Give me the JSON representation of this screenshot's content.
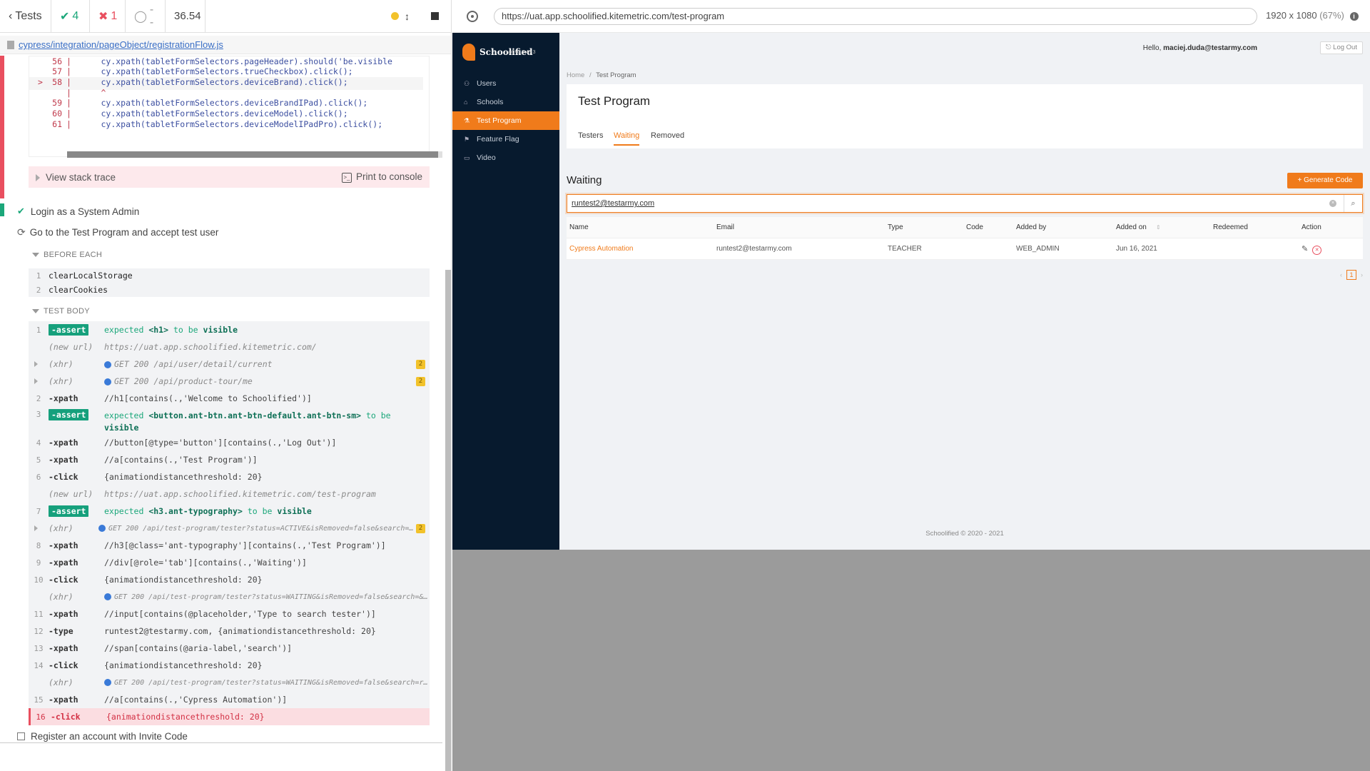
{
  "runner": {
    "tests_label": "Tests",
    "passed": "4",
    "failed": "1",
    "pending": "--",
    "duration": "36.54",
    "spec_path": "cypress/integration/pageObject/registrationFlow.js",
    "code_lines": [
      {
        "ln": "56",
        "arrow": "",
        "code": "      cy.xpath(tabletFormSelectors.pageHeader).should('be.visible"
      },
      {
        "ln": "57",
        "arrow": "",
        "code": "      cy.xpath(tabletFormSelectors.trueCheckbox).click();"
      },
      {
        "ln": "58",
        "arrow": ">",
        "code": "      cy.xpath(tabletFormSelectors.deviceBrand).click();"
      },
      {
        "ln": "",
        "arrow": "",
        "code": "      ^"
      },
      {
        "ln": "59",
        "arrow": "",
        "code": "      cy.xpath(tabletFormSelectors.deviceBrandIPad).click();"
      },
      {
        "ln": "60",
        "arrow": "",
        "code": "      cy.xpath(tabletFormSelectors.deviceModel).click();"
      },
      {
        "ln": "61",
        "arrow": "",
        "code": "      cy.xpath(tabletFormSelectors.deviceModelIPadPro).click();"
      }
    ],
    "view_stack_trace": "View stack trace",
    "print_to_console": "Print to console",
    "tests": {
      "t1": "Login as a System Admin",
      "t2": "Go to the Test Program and accept test user",
      "t3": "Register an account with Invite Code"
    },
    "before_each": "BEFORE EACH",
    "before_each_cmds": [
      {
        "num": "1",
        "msg": "clearLocalStorage"
      },
      {
        "num": "2",
        "msg": "clearCookies"
      }
    ],
    "test_body": "TEST BODY",
    "commands": {
      "c1": {
        "num": "1",
        "name": "-assert",
        "pre": "expected",
        "el": "<h1>",
        "mid": "to be",
        "end": "visible"
      },
      "u1": {
        "name": "(new url)",
        "msg": "https://uat.app.schoolified.kitemetric.com/"
      },
      "x1": {
        "name": "(xhr)",
        "msg": "GET 200 /api/user/detail/current",
        "badge": "2"
      },
      "x2": {
        "name": "(xhr)",
        "msg": "GET 200 /api/product-tour/me",
        "badge": "2"
      },
      "c2": {
        "num": "2",
        "name": "-xpath",
        "msg": "//h1[contains(.,'Welcome to Schoolified')]"
      },
      "c3": {
        "num": "3",
        "name": "-assert",
        "pre": "expected",
        "el": "<button.ant-btn.ant-btn-default.ant-btn-sm>",
        "mid": "to be",
        "end": "visible"
      },
      "c4": {
        "num": "4",
        "name": "-xpath",
        "msg": "//button[@type='button'][contains(.,'Log Out')]"
      },
      "c5": {
        "num": "5",
        "name": "-xpath",
        "msg": "//a[contains(.,'Test Program')]"
      },
      "c6": {
        "num": "6",
        "name": "-click",
        "msg": "{animationdistancethreshold: 20}"
      },
      "u2": {
        "name": "(new url)",
        "msg": "https://uat.app.schoolified.kitemetric.com/test-program"
      },
      "c7": {
        "num": "7",
        "name": "-assert",
        "pre": "expected",
        "el": "<h3.ant-typography>",
        "mid": "to be",
        "end": "visible"
      },
      "x3": {
        "name": "(xhr)",
        "msg": "GET 200 /api/test-program/tester?status=ACTIVE&isRemoved=false&search=&size…",
        "badge": "2"
      },
      "c8": {
        "num": "8",
        "name": "-xpath",
        "msg": "//h3[@class='ant-typography'][contains(.,'Test Program')]"
      },
      "c9": {
        "num": "9",
        "name": "-xpath",
        "msg": "//div[@role='tab'][contains(.,'Waiting')]"
      },
      "c10": {
        "num": "10",
        "name": "-click",
        "msg": "{animationdistancethreshold: 20}"
      },
      "x4": {
        "name": "(xhr)",
        "msg": "GET 200 /api/test-program/tester?status=WAITING&isRemoved=false&search=&size…"
      },
      "c11": {
        "num": "11",
        "name": "-xpath",
        "msg": "//input[contains(@placeholder,'Type to search tester')]"
      },
      "c12": {
        "num": "12",
        "name": "-type",
        "msg": "runtest2@testarmy.com, {animationdistancethreshold: 20}"
      },
      "c13": {
        "num": "13",
        "name": "-xpath",
        "msg": "//span[contains(@aria-label,'search')]"
      },
      "c14": {
        "num": "14",
        "name": "-click",
        "msg": "{animationdistancethreshold: 20}"
      },
      "x5": {
        "name": "(xhr)",
        "msg": "GET 200 /api/test-program/tester?status=WAITING&isRemoved=false&search=runte…"
      },
      "c15": {
        "num": "15",
        "name": "-xpath",
        "msg": "//a[contains(.,'Cypress Automation')]"
      },
      "c16": {
        "num": "16",
        "name": "-click",
        "msg": "{animationdistancethreshold: 20}"
      }
    }
  },
  "aut_bar": {
    "url": "https://uat.app.schoolified.kitemetric.com/test-program",
    "viewport": "1920 x 1080",
    "scale": "(67%)"
  },
  "app": {
    "brand": "Schoolified",
    "version": "uat v0.3.49.3",
    "nav": [
      {
        "label": "Users",
        "icon": "user-icon"
      },
      {
        "label": "Schools",
        "icon": "home-icon"
      },
      {
        "label": "Test Program",
        "icon": "flask-icon"
      },
      {
        "label": "Feature Flag",
        "icon": "flag-icon"
      },
      {
        "label": "Video",
        "icon": "video-icon"
      }
    ],
    "hello_prefix": "Hello,",
    "user_email": "maciej.duda@testarmy.com",
    "logout": "Log Out",
    "breadcrumb": {
      "home": "Home",
      "sep": "/",
      "current": "Test Program"
    },
    "page_title": "Test Program",
    "tabs": [
      "Testers",
      "Waiting",
      "Removed"
    ],
    "section_title": "Waiting",
    "generate_code": "Generate Code",
    "search_value": "runtest2@testarmy.com",
    "columns": [
      "Name",
      "Email",
      "Type",
      "Code",
      "Added by",
      "Added on",
      "Redeemed",
      "Action"
    ],
    "rows": [
      {
        "name": "Cypress Automation",
        "email": "runtest2@testarmy.com",
        "type": "TEACHER",
        "code": "",
        "added_by": "WEB_ADMIN",
        "added_on": "Jun 16, 2021",
        "redeemed": ""
      }
    ],
    "page": "1",
    "footer": "Schoolified © 2020 - 2021"
  },
  "colors": {
    "accent": "#f07b1b",
    "sidebar": "#071a2e",
    "pass": "#1ba77a",
    "fail": "#e94f5f"
  }
}
